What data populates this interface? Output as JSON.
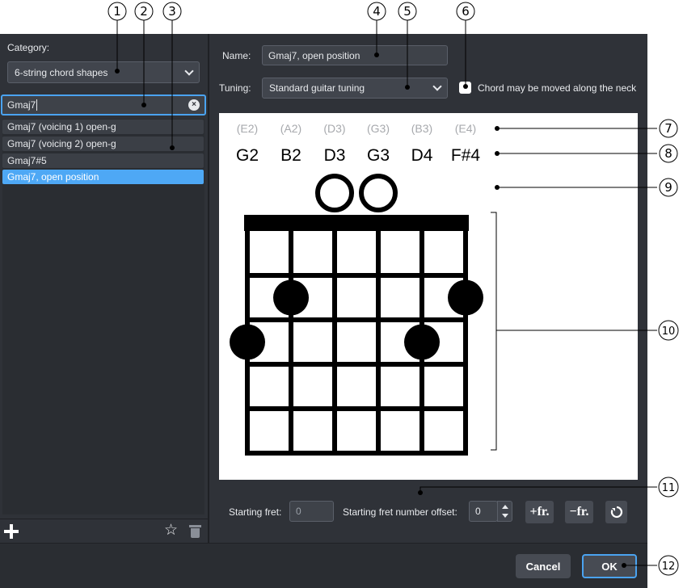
{
  "left_panel": {
    "category_label": "Category:",
    "category_value": "6-string chord shapes",
    "search_value": "Gmaj7",
    "results": [
      "Gmaj7 (voicing 1) open-g",
      "Gmaj7 (voicing 2) open-g",
      "Gmaj7#5",
      "Gmaj7, open position"
    ],
    "selected_index": 3
  },
  "form": {
    "name_label": "Name:",
    "name_value": "Gmaj7, open position",
    "tuning_label": "Tuning:",
    "tuning_value": "Standard guitar tuning",
    "movable_label": "Chord may be moved along the neck",
    "movable_checked": false
  },
  "diagram": {
    "standard_tuning": [
      "(E2)",
      "(A2)",
      "(D3)",
      "(G3)",
      "(B3)",
      "(E4)"
    ],
    "current_tuning": [
      "G2",
      "B2",
      "D3",
      "G3",
      "D4",
      "F#4"
    ],
    "open_strings": [
      3,
      4
    ],
    "fretted_notes": [
      {
        "string": 1,
        "fret": 3
      },
      {
        "string": 2,
        "fret": 2
      },
      {
        "string": 5,
        "fret": 3
      },
      {
        "string": 6,
        "fret": 2
      }
    ],
    "fret_count": 5,
    "string_count": 6
  },
  "controls": {
    "starting_fret_label": "Starting fret:",
    "starting_fret_value": "0",
    "offset_label": "Starting fret number offset:",
    "offset_value": "0",
    "add_fret_label": "+fr.",
    "remove_fret_label": "−fr."
  },
  "footer": {
    "cancel_label": "Cancel",
    "ok_label": "OK"
  },
  "callouts": [
    "1",
    "2",
    "3",
    "4",
    "5",
    "6",
    "7",
    "8",
    "9",
    "10",
    "11",
    "12"
  ],
  "colors": {
    "accent": "#4aa3f0",
    "selected_row": "#4ea8f5",
    "panel": "#2f3238"
  }
}
